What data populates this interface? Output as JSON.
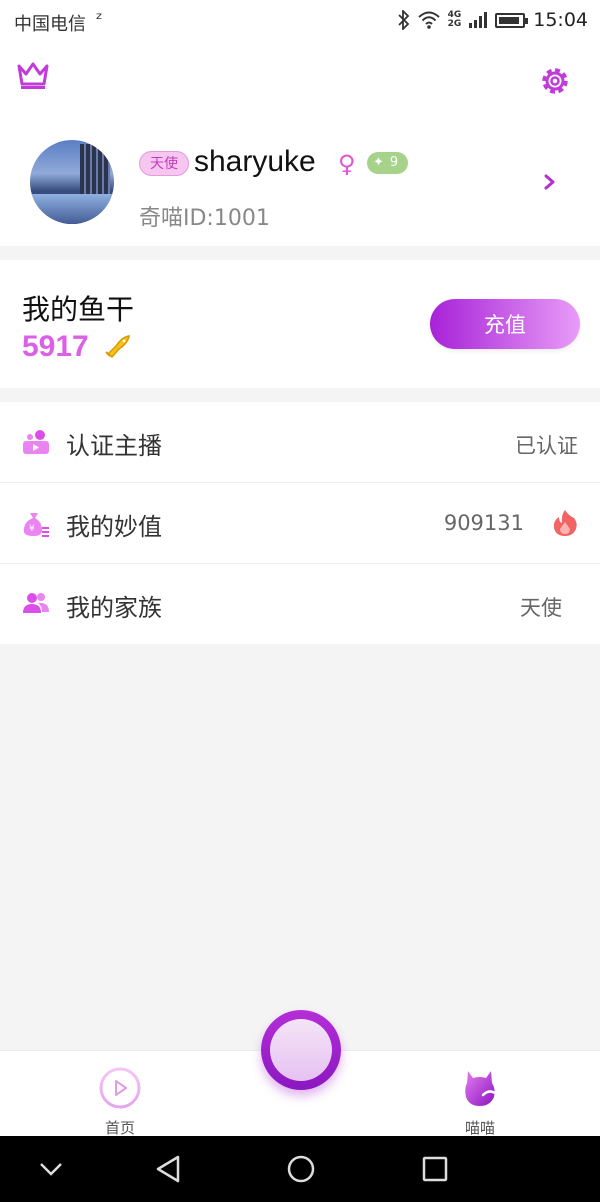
{
  "status_bar": {
    "carrier": "中国电信",
    "carrier_extra": "ᶻ",
    "network_4g": "4G",
    "network_2g": "2G",
    "battery_level": 0.9,
    "time": "15:04"
  },
  "topbar": {
    "crown_icon": "crown-icon",
    "settings_icon": "gear-icon",
    "accent_color": "#c13bd9"
  },
  "profile": {
    "role_badge": "天使",
    "username": "sharyuke",
    "gender_symbol": "♀",
    "level_symbol": "✦",
    "level": "9",
    "id_text": "奇喵ID:1001"
  },
  "wallet": {
    "title": "我的鱼干",
    "amount": "5917",
    "recharge_label": "充值",
    "amount_color": "#dd5fe8"
  },
  "menu": {
    "items": [
      {
        "label": "认证主播",
        "value": "已认证",
        "icon": "video-user-icon"
      },
      {
        "label": "我的妙值",
        "value": "909131",
        "icon": "money-bag-icon"
      },
      {
        "label": "我的家族",
        "value": "天使",
        "icon": "family-icon"
      }
    ]
  },
  "tabbar": {
    "tabs": [
      {
        "label": "首页",
        "icon": "play-circle-icon"
      },
      {
        "label": "喵喵",
        "icon": "cat-icon"
      }
    ]
  },
  "navbar": {
    "buttons": [
      "chevron-down-icon",
      "back-triangle-icon",
      "home-circle-icon",
      "recents-square-icon"
    ]
  }
}
